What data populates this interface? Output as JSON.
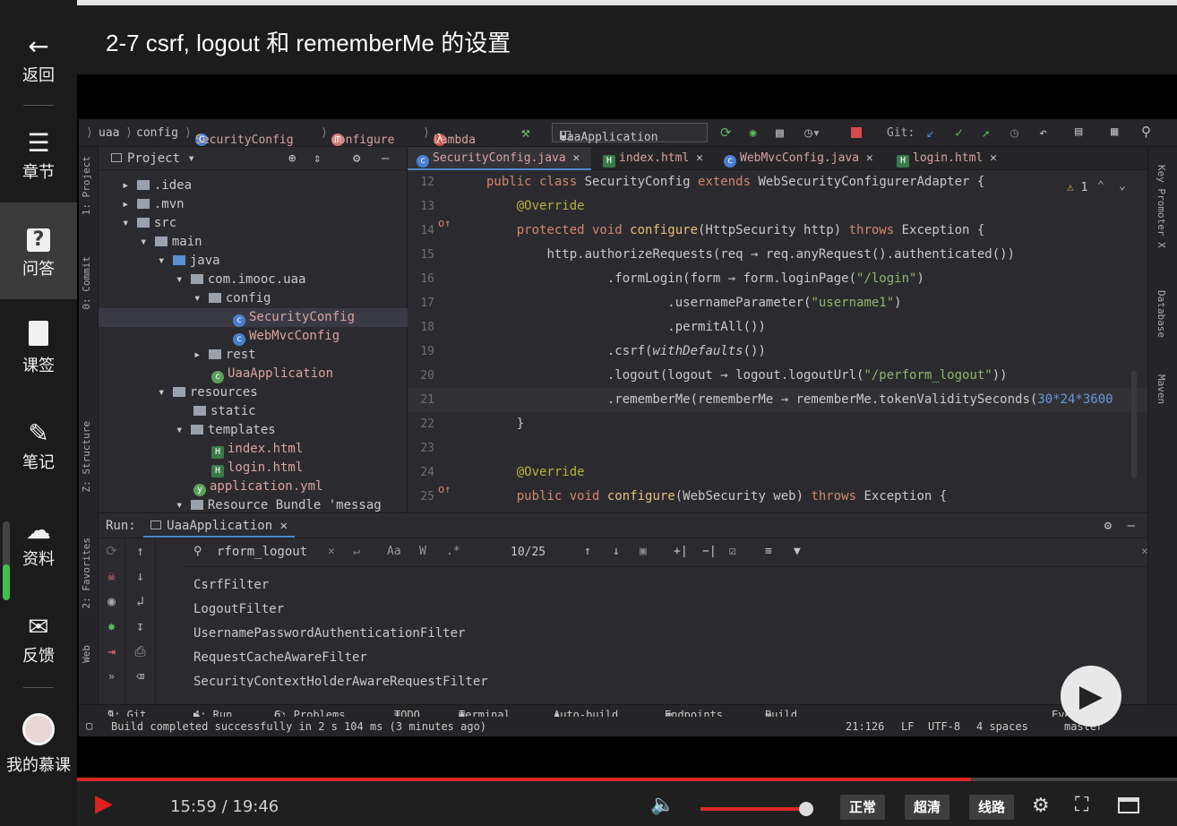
{
  "title": "2-7 csrf, logout 和 rememberMe 的设置",
  "sidebar": {
    "items": [
      {
        "label": "返回",
        "icon": "back-arrow-icon"
      },
      {
        "label": "章节",
        "icon": "menu-icon"
      },
      {
        "label": "问答",
        "icon": "question-icon"
      },
      {
        "label": "课签",
        "icon": "bookmark-icon"
      },
      {
        "label": "笔记",
        "icon": "pencil-icon"
      },
      {
        "label": "资料",
        "icon": "cloud-download-icon"
      },
      {
        "label": "反馈",
        "icon": "mail-icon"
      },
      {
        "label": "我的慕课",
        "icon": "avatar"
      }
    ]
  },
  "ide": {
    "nav": {
      "crumbs": [
        "uaa",
        "config",
        "SecurityConfig",
        "configure",
        "Lambda"
      ],
      "run_config": "UaaApplication",
      "git_label": "Git:"
    },
    "project_header": "Project",
    "tree": [
      ".idea",
      ".mvn",
      "src",
      "main",
      "java",
      "com.imooc.uaa",
      "config",
      "SecurityConfig",
      "WebMvcConfig",
      "rest",
      "UaaApplication",
      "resources",
      "static",
      "templates",
      "index.html",
      "login.html",
      "application.yml",
      "Resource Bundle 'messag"
    ],
    "tabs": [
      "SecurityConfig.java",
      "index.html",
      "WebMvcConfig.java",
      "login.html"
    ],
    "warn_count": "1",
    "left_tools": [
      "1: Project",
      "0: Commit",
      "Z: Structure",
      "2: Favorites",
      "Web"
    ],
    "right_tools": [
      "Key Promoter X",
      "Database",
      "Maven"
    ],
    "code": {
      "line_numbers": [
        "12",
        "13",
        "14",
        "15",
        "16",
        "17",
        "18",
        "19",
        "20",
        "21",
        "22",
        "23",
        "24",
        "25"
      ],
      "l12": [
        "public class ",
        "SecurityConfig ",
        "extends ",
        "WebSecurityConfigurerAdapter {"
      ],
      "l13": "@Override",
      "l14": [
        "protected void ",
        "configure",
        "(HttpSecurity http) ",
        "throws ",
        "Exception {"
      ],
      "l15": "http.authorizeRequests(req → req.anyRequest().authenticated())",
      "l16": [
        ".formLogin(form → form.loginPage(",
        "\"/login\"",
        ")"
      ],
      "l17": [
        ".usernameParameter(",
        "\"username1\"",
        ")"
      ],
      "l18": ".permitAll())",
      "l19": [
        ".csrf(",
        "withDefaults",
        "())"
      ],
      "l20": [
        ".logout(logout → logout.logoutUrl(",
        "\"/perform_logout\"",
        "))"
      ],
      "l21": [
        ".rememberMe(rememberMe → rememberMe.tokenValiditySeconds(",
        "30*24*3600"
      ],
      "l22": "}",
      "l24": "@Override",
      "l25": [
        "public void ",
        "configure",
        "(WebSecurity web) ",
        "throws ",
        "Exception {"
      ]
    },
    "run": {
      "label": "Run:",
      "tab": "UaaApplication",
      "search_value": "rform_logout",
      "match_case": "Aa",
      "words": "W",
      "regex": ".*",
      "match_count": "10/25",
      "output": [
        "CsrfFilter",
        "LogoutFilter",
        "UsernamePasswordAuthenticationFilter",
        "RequestCacheAwareFilter",
        "SecurityContextHolderAwareRequestFilter"
      ]
    },
    "bottom_tabs": [
      "9: Git",
      "4: Run",
      "6: Problems",
      "TODO",
      "Terminal",
      "Auto-build",
      "Endpoints",
      "Build",
      "Event Log"
    ],
    "status": {
      "message": "Build completed successfully in 2 s 104 ms (3 minutes ago)",
      "position": "21:126",
      "line_sep": "LF",
      "encoding": "UTF-8",
      "indent": "4 spaces",
      "branch": "master"
    }
  },
  "player": {
    "time": "15:59 / 19:46",
    "progress": 0.813,
    "volume": 1.0,
    "buttons": [
      "正常",
      "超清",
      "线路"
    ],
    "accent": "#d92828"
  }
}
